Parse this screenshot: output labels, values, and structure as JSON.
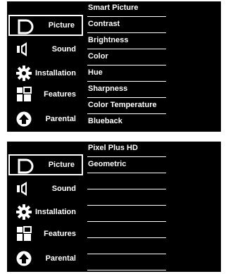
{
  "sidebar": {
    "items": [
      {
        "label": "Picture",
        "icon": "picture-icon"
      },
      {
        "label": "Sound",
        "icon": "speaker-icon"
      },
      {
        "label": "Installation",
        "icon": "gear-icon"
      },
      {
        "label": "Features",
        "icon": "features-icon"
      },
      {
        "label": "Parental",
        "icon": "arrow-up-icon"
      }
    ]
  },
  "menu_page1": {
    "items": [
      "Smart Picture",
      "Contrast",
      "Brightness",
      "Color",
      "Hue",
      "Sharpness",
      "Color Temperature",
      "Blueback"
    ]
  },
  "menu_page2": {
    "items": [
      "Pixel Plus HD",
      "Geometric",
      "",
      "",
      "",
      "",
      "",
      ""
    ]
  },
  "colors": {
    "background": "#000000",
    "text": "#ffffff",
    "border": "#ffffff"
  }
}
